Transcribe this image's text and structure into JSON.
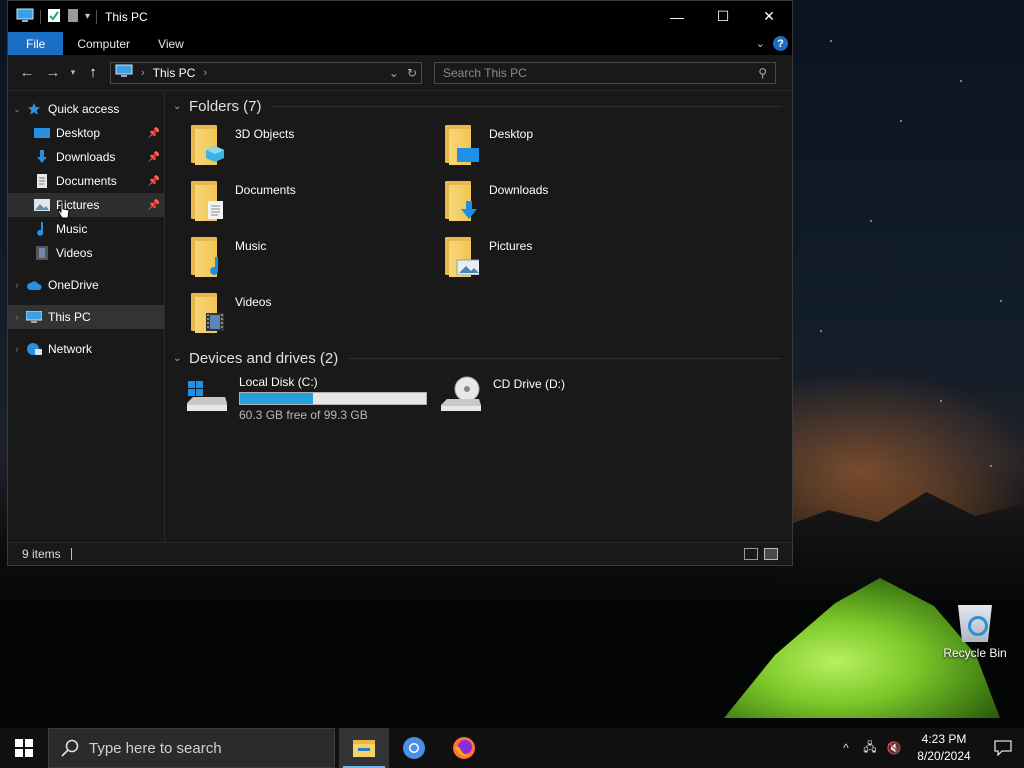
{
  "window": {
    "title": "This PC",
    "controls": {
      "minimize": "—",
      "maximize": "☐",
      "close": "✕"
    }
  },
  "ribbon": {
    "tabs": [
      "File",
      "Computer",
      "View"
    ],
    "help": "?"
  },
  "address": {
    "crumb": "This PC",
    "search_placeholder": "Search This PC"
  },
  "nav_pane": {
    "quick_access": "Quick access",
    "quick_items": [
      {
        "label": "Desktop",
        "pinned": true
      },
      {
        "label": "Downloads",
        "pinned": true
      },
      {
        "label": "Documents",
        "pinned": true
      },
      {
        "label": "Pictures",
        "pinned": true
      },
      {
        "label": "Music",
        "pinned": false
      },
      {
        "label": "Videos",
        "pinned": false
      }
    ],
    "onedrive": "OneDrive",
    "this_pc": "This PC",
    "network": "Network"
  },
  "content": {
    "folders_header": "Folders (7)",
    "folders": [
      "3D Objects",
      "Desktop",
      "Documents",
      "Downloads",
      "Music",
      "Pictures",
      "Videos"
    ],
    "drives_header": "Devices and drives (2)",
    "drives": [
      {
        "name": "Local Disk (C:)",
        "free_text": "60.3 GB free of 99.3 GB",
        "used_fraction": 0.39
      },
      {
        "name": "CD Drive (D:)"
      }
    ]
  },
  "status": {
    "items": "9 items"
  },
  "desktop": {
    "recycle_bin": "Recycle Bin"
  },
  "taskbar": {
    "search_placeholder": "Type here to search",
    "time": "4:23 PM",
    "date": "8/20/2024"
  },
  "colors": {
    "accent": "#1a6ec4",
    "drive_bar": "#26a0da",
    "folder": "#f1c552"
  }
}
